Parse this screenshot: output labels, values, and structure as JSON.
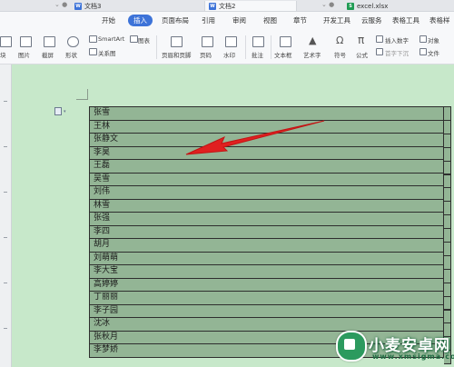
{
  "tabs": [
    {
      "label": "文档3",
      "icon": "word-doc-icon"
    },
    {
      "label": "文档2",
      "icon": "word-doc-icon"
    },
    {
      "label": "excel.xlsx",
      "icon": "excel-icon"
    }
  ],
  "menu": {
    "items": [
      "开始",
      "插入",
      "页面布局",
      "引用",
      "审阅",
      "视图",
      "章节",
      "开发工具",
      "云服务",
      "表格工具",
      "表格样"
    ],
    "active": "插入"
  },
  "ribbon": {
    "items": [
      {
        "label": "块",
        "icon": "blank-page-icon"
      },
      {
        "label": "图片",
        "icon": "image-icon"
      },
      {
        "label": "截屏",
        "icon": "screenshot-icon"
      },
      {
        "label": "形状",
        "icon": "shape-icon"
      },
      {
        "label": "SmartArt",
        "icon": "smartart-icon"
      },
      {
        "label": "图表",
        "icon": "chart-icon"
      },
      {
        "label": "关系图",
        "icon": "relation-chart-icon"
      },
      {
        "label": "页眉和页脚",
        "icon": "header-footer-icon"
      },
      {
        "label": "页码",
        "icon": "page-number-icon"
      },
      {
        "label": "水印",
        "icon": "watermark-icon"
      },
      {
        "label": "批注",
        "icon": "comment-icon"
      },
      {
        "label": "文本框",
        "icon": "textbox-icon"
      },
      {
        "label": "艺术字",
        "icon": "wordart-icon"
      },
      {
        "label": "符号",
        "icon": "symbol-icon"
      },
      {
        "label": "公式",
        "icon": "formula-icon"
      },
      {
        "label": "插入数字",
        "icon": "insert-number-icon"
      },
      {
        "label": "首字下沉",
        "icon": "drop-cap-icon"
      },
      {
        "label": "对象",
        "icon": "object-icon"
      },
      {
        "label": "文件",
        "icon": "file-icon"
      }
    ]
  },
  "table": {
    "names": [
      "张雪",
      "王林",
      "张静文",
      "李昊",
      "王磊",
      "吴雪",
      "刘伟",
      "林雪",
      "张强",
      "李四",
      "胡月",
      "刘萌萌",
      "李大宝",
      "高婷婷",
      "丁丽丽",
      "李子园",
      "沈冰",
      "张秋月",
      "李梦娇"
    ]
  },
  "watermark": {
    "brand": "小麦安卓网",
    "url": "www.xmsigma.com"
  },
  "colors": {
    "accent": "#3d73d8",
    "doc_bg": "#c7e8ca",
    "table_fill": "#93b595",
    "arrow": "#e02020",
    "brand_green": "#2c9a5e"
  }
}
